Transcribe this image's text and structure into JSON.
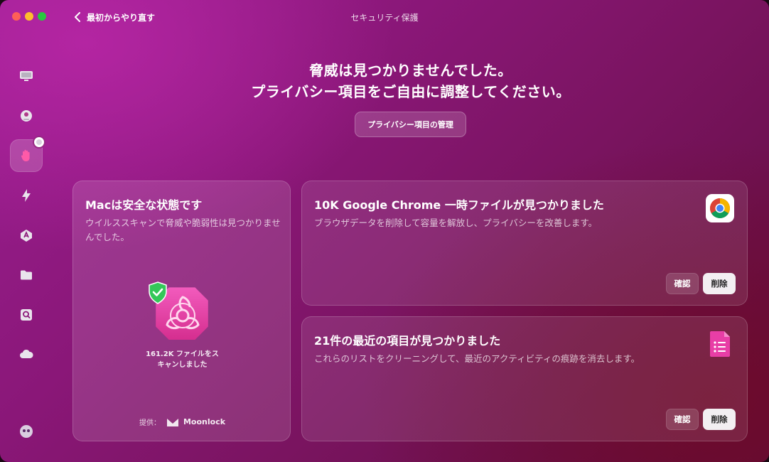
{
  "window": {
    "title": "セキュリティ保護",
    "back_label": "最初からやり直す"
  },
  "sidebar": {
    "items": [
      {
        "icon": "monitor-icon"
      },
      {
        "icon": "disk-icon"
      },
      {
        "icon": "hand-icon",
        "active": true
      },
      {
        "icon": "lightning-icon"
      },
      {
        "icon": "applications-icon"
      },
      {
        "icon": "folder-icon"
      },
      {
        "icon": "search-disk-icon"
      },
      {
        "icon": "cloud-icon"
      },
      {
        "icon": "assistant-icon"
      }
    ]
  },
  "hero": {
    "line1": "脅威は見つかりませんでした。",
    "line2": "プライバシー項目をご自由に調整してください。",
    "manage_button": "プライバシー項目の管理"
  },
  "mac_card": {
    "title": "Macは安全な状態です",
    "description": "ウイルススキャンで脅威や脆弱性は見つかりませんでした。",
    "scan_line1": "161.2K ファイルをス",
    "scan_line2": "キャンしました",
    "provided_by": "提供：",
    "brand": "Moonlock"
  },
  "chrome_card": {
    "title": "10K Google Chrome 一時ファイルが見つかりました",
    "description": "ブラウザデータを削除して容量を解放し、プライバシーを改善します。",
    "review_label": "確認",
    "delete_label": "削除",
    "icon": "chrome-icon"
  },
  "recent_card": {
    "title": "21件の最近の項目が見つかりました",
    "description": "これらのリストをクリーニングして、最近のアクティビティの痕跡を消去します。",
    "review_label": "確認",
    "delete_label": "削除",
    "icon": "recent-items-icon"
  },
  "colors": {
    "accent_pink": "#e93fa8",
    "shield_green": "#34c759"
  }
}
